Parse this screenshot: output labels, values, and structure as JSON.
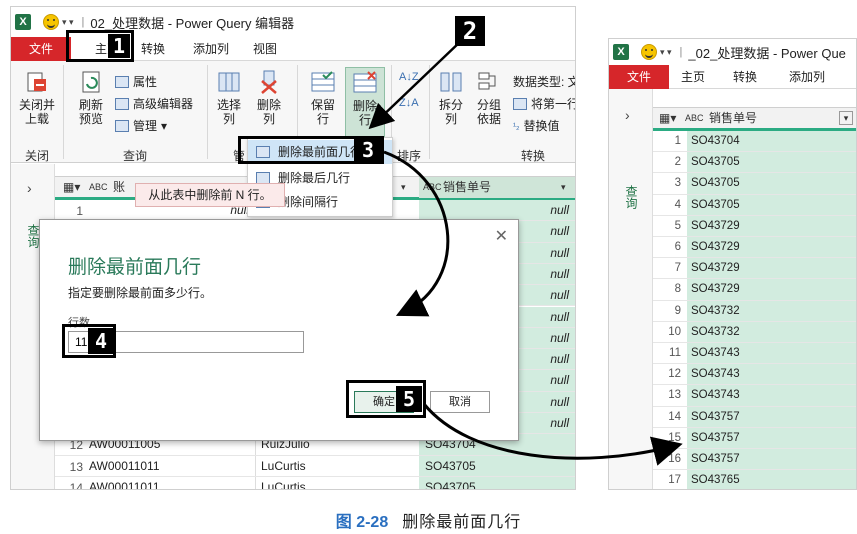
{
  "left_window": {
    "title": "02_处理数据 - Power Query 编辑器",
    "tabs": [
      "文件",
      "主页",
      "转换",
      "添加列",
      "视图"
    ],
    "ribbon": {
      "close_load": "关闭并\n上载",
      "refresh_preview": "刷新\n预览",
      "properties": "属性",
      "advanced_editor": "高级编辑器",
      "manage": "管理",
      "choose_columns": "选择\n列",
      "remove_columns": "删除\n列",
      "keep_rows": "保留\n行",
      "remove_rows": "删除\n行",
      "split_column": "拆分\n列",
      "group_by": "分组\n依据",
      "data_type": "数据类型: 文",
      "first_row_header": "将第一行",
      "replace_values": "替换值",
      "group_close": "关闭",
      "group_query": "查询",
      "group_manage": "管",
      "group_sort": "排序",
      "group_transform": "转换"
    },
    "nav_label": "查询",
    "dropdown": [
      "删除最前面几行",
      "删除最后几行",
      "删除间隔行"
    ],
    "tooltip": "从此表中删除前 N 行。",
    "grid_header": {
      "col1": "账",
      "col3": "销售单号"
    },
    "null_text": "null",
    "bottom_rows": [
      {
        "n": "12",
        "id": "AW00011005",
        "name": "RuizJulio",
        "order": "SO43704"
      },
      {
        "n": "13",
        "id": "AW00011011",
        "name": "LuCurtis",
        "order": "SO43705"
      },
      {
        "n": "14",
        "id": "AW00011011",
        "name": "LuCurtis",
        "order": "SO43705"
      }
    ],
    "first_row_num": "1",
    "dialog": {
      "title": "删除最前面几行",
      "desc": "指定要删除最前面多少行。",
      "label": "行数",
      "value": "11",
      "ok": "确定",
      "cancel": "取消"
    },
    "badges": [
      "1",
      "2",
      "3",
      "4",
      "5"
    ]
  },
  "right_window": {
    "title": "_02_处理数据 - Power Que",
    "tabs": [
      "文件",
      "主页",
      "转换",
      "添加列"
    ],
    "nav_label": "查询",
    "header": "销售单号",
    "rows": [
      {
        "n": "1",
        "v": "SO43704"
      },
      {
        "n": "2",
        "v": "SO43705"
      },
      {
        "n": "3",
        "v": "SO43705"
      },
      {
        "n": "4",
        "v": "SO43705"
      },
      {
        "n": "5",
        "v": "SO43729"
      },
      {
        "n": "6",
        "v": "SO43729"
      },
      {
        "n": "7",
        "v": "SO43729"
      },
      {
        "n": "8",
        "v": "SO43729"
      },
      {
        "n": "9",
        "v": "SO43732"
      },
      {
        "n": "10",
        "v": "SO43732"
      },
      {
        "n": "11",
        "v": "SO43743"
      },
      {
        "n": "12",
        "v": "SO43743"
      },
      {
        "n": "13",
        "v": "SO43743"
      },
      {
        "n": "14",
        "v": "SO43757"
      },
      {
        "n": "15",
        "v": "SO43757"
      },
      {
        "n": "16",
        "v": "SO43757"
      },
      {
        "n": "17",
        "v": "SO43765"
      }
    ]
  },
  "caption": {
    "number": "图 2-28",
    "text": "删除最前面几行"
  },
  "colors": {
    "excel_green": "#217346",
    "file_red": "#d6262a",
    "accent_green": "#2bab83",
    "cell_green": "#d2ecdf",
    "caption_blue": "#2a6fc0"
  }
}
